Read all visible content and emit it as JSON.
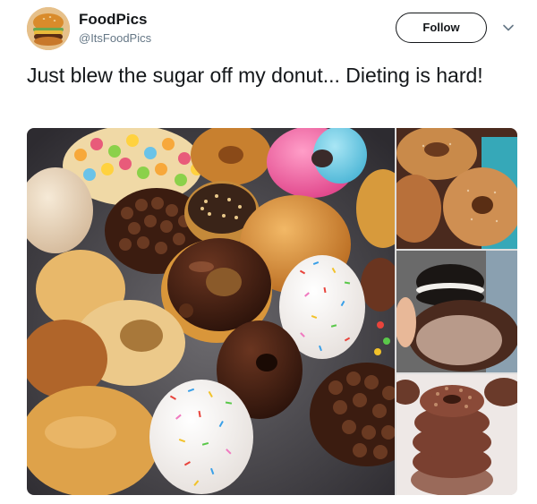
{
  "author": {
    "display_name": "FoodPics",
    "handle": "@ItsFoodPics",
    "avatar_icon": "burger-avatar-icon"
  },
  "actions": {
    "follow_label": "Follow",
    "more_icon": "chevron-down-icon"
  },
  "tweet": {
    "text": "Just blew the sugar off my donut... Dieting is hard!"
  },
  "media": {
    "photos": [
      {
        "name": "donut-platter-photo",
        "icon": "donuts-photo"
      },
      {
        "name": "cinnamon-sugar-donuts-photo",
        "icon": "donuts-photo"
      },
      {
        "name": "oreo-donut-photo",
        "icon": "donuts-photo"
      },
      {
        "name": "chocolate-donut-stack-photo",
        "icon": "donuts-photo"
      }
    ]
  },
  "colors": {
    "text_primary": "#14171a",
    "text_secondary": "#657786",
    "border": "#14171a"
  }
}
